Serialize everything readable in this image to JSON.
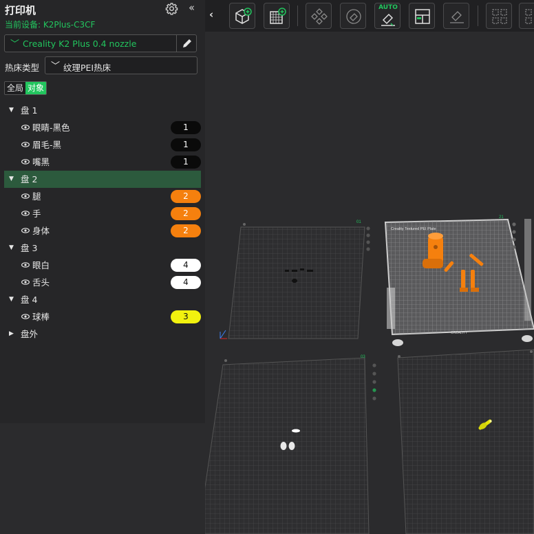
{
  "panel": {
    "title": "打印机",
    "device_label": "当前设备: K2Plus-C3CF",
    "printer_select_value": "Creality K2 Plus 0.4 nozzle",
    "bed_type_label": "热床类型",
    "bed_type_value": "纹理PEI热床",
    "tab_global": "全局",
    "tab_object": "对象"
  },
  "tree": {
    "plate1": "盘 1",
    "plate1_items": [
      {
        "name": "眼睛-黑色",
        "filament": "1"
      },
      {
        "name": "眉毛-黑",
        "filament": "1"
      },
      {
        "name": "嘴黑",
        "filament": "1"
      }
    ],
    "plate2": "盘 2",
    "plate2_items": [
      {
        "name": "腿",
        "filament": "2"
      },
      {
        "name": "手",
        "filament": "2"
      },
      {
        "name": "身体",
        "filament": "2"
      }
    ],
    "plate3": "盘 3",
    "plate3_items": [
      {
        "name": "眼白",
        "filament": "4"
      },
      {
        "name": "舌头",
        "filament": "4"
      }
    ],
    "plate4": "盘 4",
    "plate4_items": [
      {
        "name": "球棒",
        "filament": "3"
      }
    ],
    "outside": "盘外"
  },
  "filament_colors": {
    "1": "#0a0a0a",
    "2": "#f5800e",
    "3": "#f2f20f",
    "4": "#ffffff"
  },
  "toolbar": {
    "auto_label": "AUTO"
  },
  "viewport": {
    "plate_labels": [
      "01",
      "21",
      "03"
    ],
    "bed_text": "Creality Textured PEI Plate",
    "brand_text": "CREALITY"
  },
  "colors": {
    "accent": "#22c55e",
    "selected_row": "#2c5a3d",
    "model_orange": "#f5800e"
  }
}
